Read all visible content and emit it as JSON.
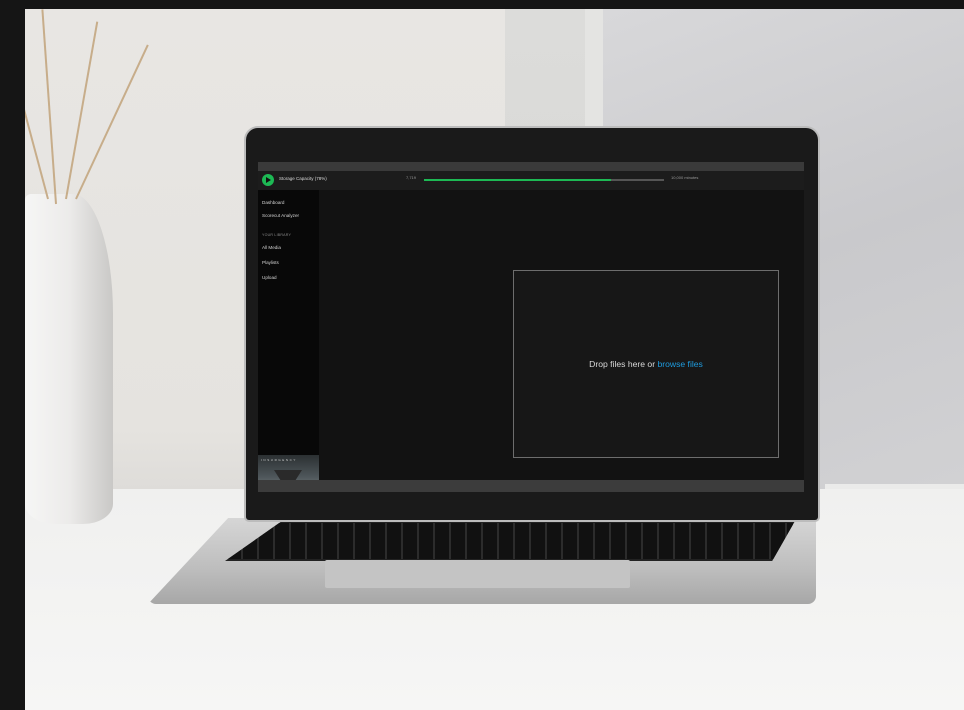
{
  "topbar": {
    "title": "Storage Capacity (78%)",
    "used": "7,719",
    "total": "10,000 minutes",
    "progress_percent": 78
  },
  "sidebar": {
    "items": [
      {
        "label": "Dashboard"
      },
      {
        "label": "Scorecut Analyzer"
      }
    ],
    "library_heading": "YOUR LIBRARY",
    "library_items": [
      {
        "label": "All Media"
      },
      {
        "label": "Playlists"
      },
      {
        "label": "Upload"
      }
    ],
    "now_playing_art": "INSURGENCY"
  },
  "dropzone": {
    "text": "Drop files here or ",
    "link": "browse files"
  },
  "colors": {
    "accent": "#1db954",
    "link": "#1e9bde",
    "background": "#121212"
  }
}
